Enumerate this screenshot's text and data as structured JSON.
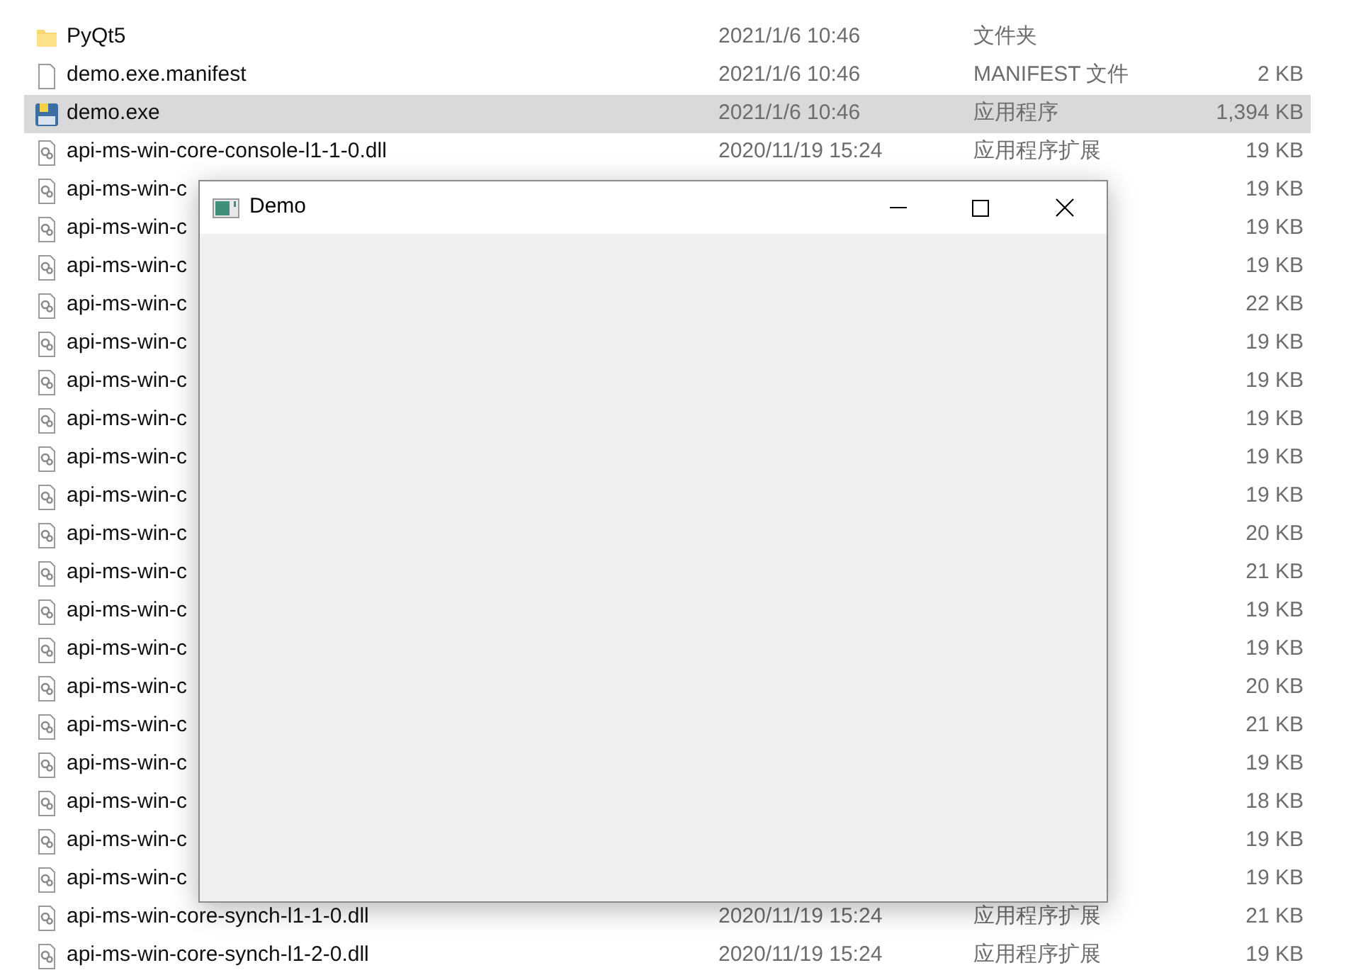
{
  "files": [
    {
      "kind": "folder",
      "name": "PyQt5",
      "date": "2021/1/6 10:46",
      "type": "文件夹",
      "selected": false
    },
    {
      "kind": "file",
      "name": "demo.exe.manifest",
      "date": "2021/1/6 10:46",
      "type": "MANIFEST 文件",
      "size": "2 KB",
      "selected": false
    },
    {
      "kind": "exe",
      "name": "demo.exe",
      "date": "2021/1/6 10:46",
      "type": "应用程序",
      "size": "1,394 KB",
      "selected": true
    },
    {
      "kind": "dll",
      "name": "api-ms-win-core-console-l1-1-0.dll",
      "date": "2020/11/19 15:24",
      "type": "应用程序扩展",
      "size": "19 KB",
      "selected": false
    },
    {
      "kind": "dll",
      "name": "api-ms-win-c",
      "size": "19 KB",
      "selected": false
    },
    {
      "kind": "dll",
      "name": "api-ms-win-c",
      "size": "19 KB",
      "selected": false
    },
    {
      "kind": "dll",
      "name": "api-ms-win-c",
      "size": "19 KB",
      "selected": false
    },
    {
      "kind": "dll",
      "name": "api-ms-win-c",
      "size": "22 KB",
      "selected": false
    },
    {
      "kind": "dll",
      "name": "api-ms-win-c",
      "size": "19 KB",
      "selected": false
    },
    {
      "kind": "dll",
      "name": "api-ms-win-c",
      "size": "19 KB",
      "selected": false
    },
    {
      "kind": "dll",
      "name": "api-ms-win-c",
      "size": "19 KB",
      "selected": false
    },
    {
      "kind": "dll",
      "name": "api-ms-win-c",
      "size": "19 KB",
      "selected": false
    },
    {
      "kind": "dll",
      "name": "api-ms-win-c",
      "size": "19 KB",
      "selected": false
    },
    {
      "kind": "dll",
      "name": "api-ms-win-c",
      "size": "20 KB",
      "selected": false
    },
    {
      "kind": "dll",
      "name": "api-ms-win-c",
      "size": "21 KB",
      "selected": false
    },
    {
      "kind": "dll",
      "name": "api-ms-win-c",
      "size": "19 KB",
      "selected": false
    },
    {
      "kind": "dll",
      "name": "api-ms-win-c",
      "size": "19 KB",
      "selected": false
    },
    {
      "kind": "dll",
      "name": "api-ms-win-c",
      "size": "20 KB",
      "selected": false
    },
    {
      "kind": "dll",
      "name": "api-ms-win-c",
      "size": "21 KB",
      "selected": false
    },
    {
      "kind": "dll",
      "name": "api-ms-win-c",
      "size": "19 KB",
      "selected": false
    },
    {
      "kind": "dll",
      "name": "api-ms-win-c",
      "size": "18 KB",
      "selected": false
    },
    {
      "kind": "dll",
      "name": "api-ms-win-c",
      "size": "19 KB",
      "selected": false
    },
    {
      "kind": "dll",
      "name": "api-ms-win-c",
      "size": "19 KB",
      "selected": false
    },
    {
      "kind": "dll",
      "name": "api-ms-win-core-synch-l1-1-0.dll",
      "date": "2020/11/19 15:24",
      "type": "应用程序扩展",
      "size": "21 KB",
      "selected": false
    },
    {
      "kind": "dll",
      "name": "api-ms-win-core-synch-l1-2-0.dll",
      "date": "2020/11/19 15:24",
      "type": "应用程序扩展",
      "size": "19 KB",
      "selected": false
    }
  ],
  "window": {
    "title": "Demo"
  }
}
